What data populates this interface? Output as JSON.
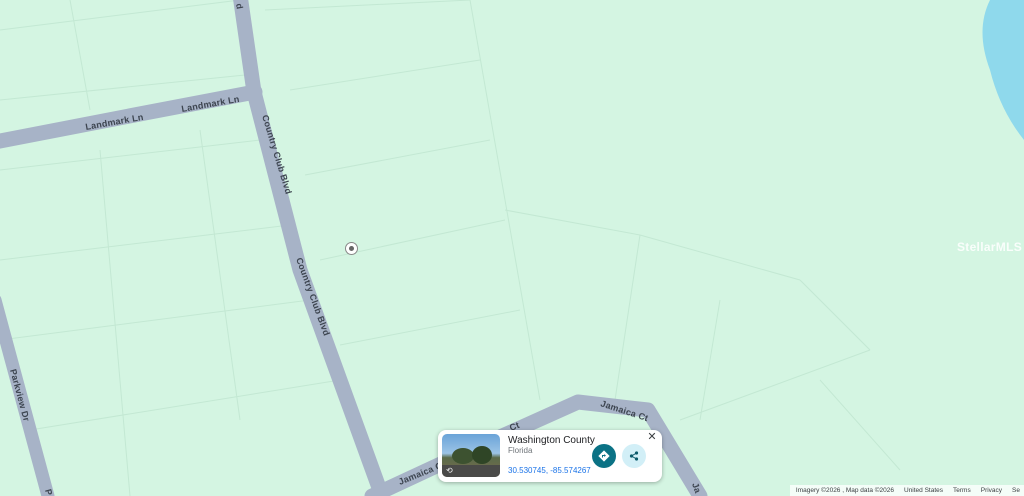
{
  "map": {
    "land_color": "#d4f5e2",
    "water_color": "#8fd9ec",
    "road_color": "#a7b3c7",
    "road_labels": {
      "landmark_ln_1": "Landmark Ln",
      "landmark_ln_2": "Landmark Ln",
      "country_club_1": "Country Club Blvd",
      "country_club_2": "Country Club Blvd",
      "parkview": "Parkview Dr",
      "jamaica_ct": "Jamaica Ct",
      "jamaica_ct_2": "Jamaica Ct",
      "jamaica_ct_3": "Jamaica Ct",
      "jamaica_ct_4": "Ja",
      "partial_left": "P",
      "partial_top": "d",
      "ct_fragment": "Ct"
    },
    "watermark": "StellarMLS"
  },
  "info_card": {
    "title": "Washington County",
    "subtitle": "Florida",
    "coords": "30.530745, -85.574267",
    "close_icon": "close-icon",
    "directions_icon": "directions-icon",
    "share_icon": "share-icon",
    "accent_color": "#0b7285"
  },
  "footer": {
    "attribution": "Imagery ©2026 , Map data ©2026",
    "region": "United States",
    "terms": "Terms",
    "privacy": "Privacy",
    "send": "Se"
  }
}
